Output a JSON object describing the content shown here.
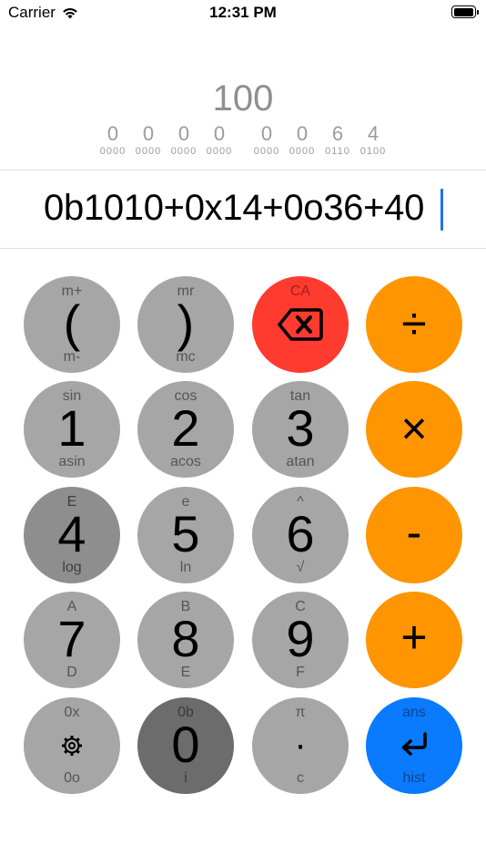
{
  "status_bar": {
    "carrier": "Carrier",
    "time": "12:31 PM"
  },
  "display": {
    "result": "100",
    "nibbles": [
      {
        "hex": "0",
        "bin": "0000"
      },
      {
        "hex": "0",
        "bin": "0000"
      },
      {
        "hex": "0",
        "bin": "0000"
      },
      {
        "hex": "0",
        "bin": "0000"
      },
      {
        "hex": "0",
        "bin": "0000"
      },
      {
        "hex": "0",
        "bin": "0000"
      },
      {
        "hex": "6",
        "bin": "0110"
      },
      {
        "hex": "4",
        "bin": "0100"
      }
    ],
    "expression": "0b1010+0x14+0o36+40"
  },
  "keypad": {
    "open_paren": {
      "top": "m+",
      "main": "(",
      "bottom": "m-"
    },
    "close_paren": {
      "top": "mr",
      "main": ")",
      "bottom": "mc"
    },
    "backspace": {
      "top": "CA",
      "icon": "backspace-icon"
    },
    "divide": {
      "main": "÷"
    },
    "one": {
      "top": "sin",
      "main": "1",
      "bottom": "asin"
    },
    "two": {
      "top": "cos",
      "main": "2",
      "bottom": "acos"
    },
    "three": {
      "top": "tan",
      "main": "3",
      "bottom": "atan"
    },
    "multiply": {
      "main": "×"
    },
    "four": {
      "top": "E",
      "main": "4",
      "bottom": "log"
    },
    "five": {
      "top": "e",
      "main": "5",
      "bottom": "ln"
    },
    "six": {
      "top": "^",
      "main": "6",
      "bottom": "√"
    },
    "minus": {
      "main": "-"
    },
    "seven": {
      "top": "A",
      "main": "7",
      "bottom": "D"
    },
    "eight": {
      "top": "B",
      "main": "8",
      "bottom": "E"
    },
    "nine": {
      "top": "C",
      "main": "9",
      "bottom": "F"
    },
    "plus": {
      "main": "+"
    },
    "settings": {
      "top": "0x",
      "icon": "gear-icon",
      "bottom": "0o"
    },
    "zero": {
      "top": "0b",
      "main": "0",
      "bottom": "i"
    },
    "dot": {
      "top": "π",
      "main": "·",
      "bottom": "c"
    },
    "enter": {
      "top": "ans",
      "icon": "return-arrow-icon",
      "bottom": "hist"
    }
  },
  "colors": {
    "key_gray": "#a6a6a6",
    "key_orange": "#ff9500",
    "key_red": "#ff3b30",
    "key_blue": "#0a7aff",
    "caret": "#1a73e8"
  }
}
